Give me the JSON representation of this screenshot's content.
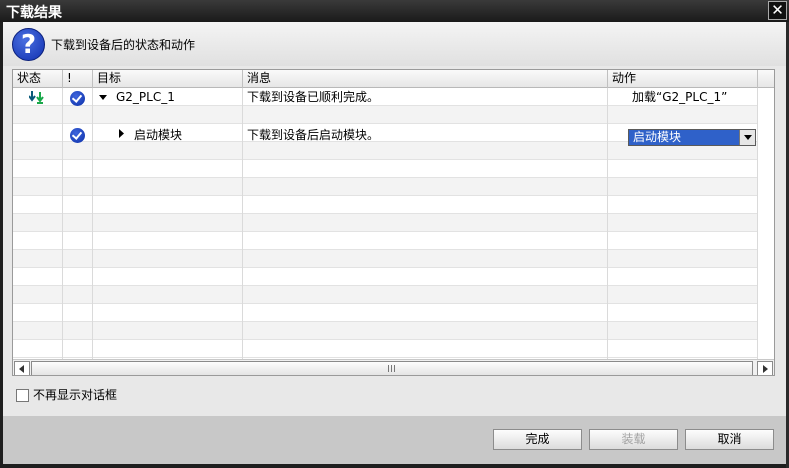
{
  "window": {
    "title": "下载结果",
    "close_icon": "close-icon"
  },
  "header": {
    "text": "下载到设备后的状态和动作",
    "icon": "help-icon"
  },
  "table": {
    "columns": [
      "状态",
      "!",
      "目标",
      "消息",
      "动作"
    ],
    "rows": [
      {
        "status_icon": "download-arrows-icon",
        "check_icon": "check-icon",
        "expand_icon": "expand-down-icon",
        "target": "G2_PLC_1",
        "message": "下载到设备已顺利完成。",
        "action": "加载“G2_PLC_1”"
      },
      {
        "check_icon": "check-icon",
        "expand_icon": "expand-right-icon",
        "target": "启动模块",
        "message": "下载到设备后启动模块。",
        "action": "启动模块"
      }
    ]
  },
  "options": {
    "dont_show_label": "不再显示对话框",
    "dont_show_checked": false
  },
  "buttons": {
    "finish": "完成",
    "load": "装载",
    "cancel": "取消",
    "load_enabled": false
  },
  "colors": {
    "accent": "#2f61c9",
    "check": "#1a3fc0",
    "titlebar": "#1e1e1e"
  }
}
